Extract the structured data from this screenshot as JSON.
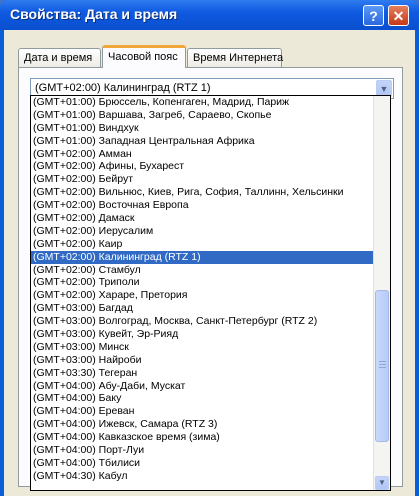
{
  "window": {
    "title": "Свойства: Дата и время",
    "help_symbol": "?",
    "close_symbol": "✕"
  },
  "tabs": [
    {
      "label": "Дата и время"
    },
    {
      "label": "Часовой пояс"
    },
    {
      "label": "Время Интернета"
    }
  ],
  "combo": {
    "value": "(GMT+02:00) Калининград (RTZ 1)",
    "arrow": "▼"
  },
  "scrollbar": {
    "down_arrow": "▼"
  },
  "list_items": [
    "(GMT+01:00) Брюссель, Копенгаген, Мадрид, Париж",
    "(GMT+01:00) Варшава, Загреб, Сараево, Скопье",
    "(GMT+01:00) Виндхук",
    "(GMT+01:00) Западная Центральная Африка",
    "(GMT+02:00) Амман",
    "(GMT+02:00) Афины, Бухарест",
    "(GMT+02:00) Бейрут",
    "(GMT+02:00) Вильнюс, Киев, Рига, София, Таллинн, Хельсинки",
    "(GMT+02:00) Восточная Европа",
    "(GMT+02:00) Дамаск",
    "(GMT+02:00) Иерусалим",
    "(GMT+02:00) Каир",
    "(GMT+02:00) Калининград (RTZ 1)",
    "(GMT+02:00) Стамбул",
    "(GMT+02:00) Триполи",
    "(GMT+02:00) Хараре, Претория",
    "(GMT+03:00) Багдад",
    "(GMT+03:00) Волгоград, Москва, Санкт-Петербург (RTZ 2)",
    "(GMT+03:00) Кувейт, Эр-Рияд",
    "(GMT+03:00) Минск",
    "(GMT+03:00) Найроби",
    "(GMT+03:30) Тегеран",
    "(GMT+04:00) Абу-Даби, Мускат",
    "(GMT+04:00) Баку",
    "(GMT+04:00) Ереван",
    "(GMT+04:00) Ижевск, Самара (RTZ 3)",
    "(GMT+04:00) Кавказское время (зима)",
    "(GMT+04:00) Порт-Луи",
    "(GMT+04:00) Тбилиси",
    "(GMT+04:30) Кабул"
  ],
  "selected_index": 12
}
